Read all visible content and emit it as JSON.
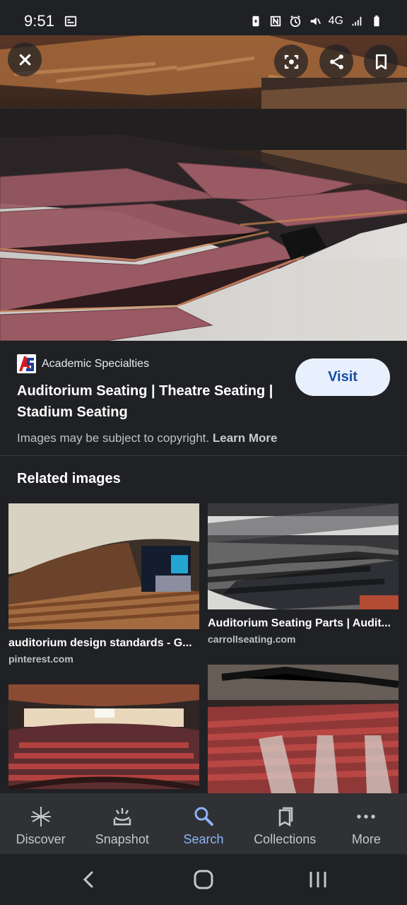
{
  "status": {
    "time": "9:51",
    "signal_label": "4G"
  },
  "hero": {
    "description_icons": [
      "close-icon",
      "lens-icon",
      "share-icon",
      "bookmark-icon"
    ]
  },
  "source": {
    "logo_text": "AS",
    "name": "Academic Specialties",
    "title": "Auditorium Seating | Theatre Seating | Stadium Seating",
    "visit_label": "Visit",
    "copyright_text": "Images may be subject to copyright.",
    "learn_more_label": "Learn More"
  },
  "related": {
    "heading": "Related images",
    "items": [
      {
        "caption": "auditorium design standards - G...",
        "domain": "pinterest.com"
      },
      {
        "caption": "Auditorium Seating Parts | Audit...",
        "domain": "carrollseating.com"
      },
      {
        "caption": "",
        "domain": ""
      },
      {
        "caption": "",
        "domain": ""
      }
    ]
  },
  "bottom_nav": {
    "items": [
      {
        "label": "Discover",
        "icon": "asterisk-icon"
      },
      {
        "label": "Snapshot",
        "icon": "snapshot-icon"
      },
      {
        "label": "Search",
        "icon": "search-icon"
      },
      {
        "label": "Collections",
        "icon": "collections-icon"
      },
      {
        "label": "More",
        "icon": "more-icon"
      }
    ]
  },
  "colors": {
    "background": "#202124",
    "accent": "#8ab4f8",
    "visit_bg": "#e8f0fe",
    "seat": "#9a5a63"
  }
}
